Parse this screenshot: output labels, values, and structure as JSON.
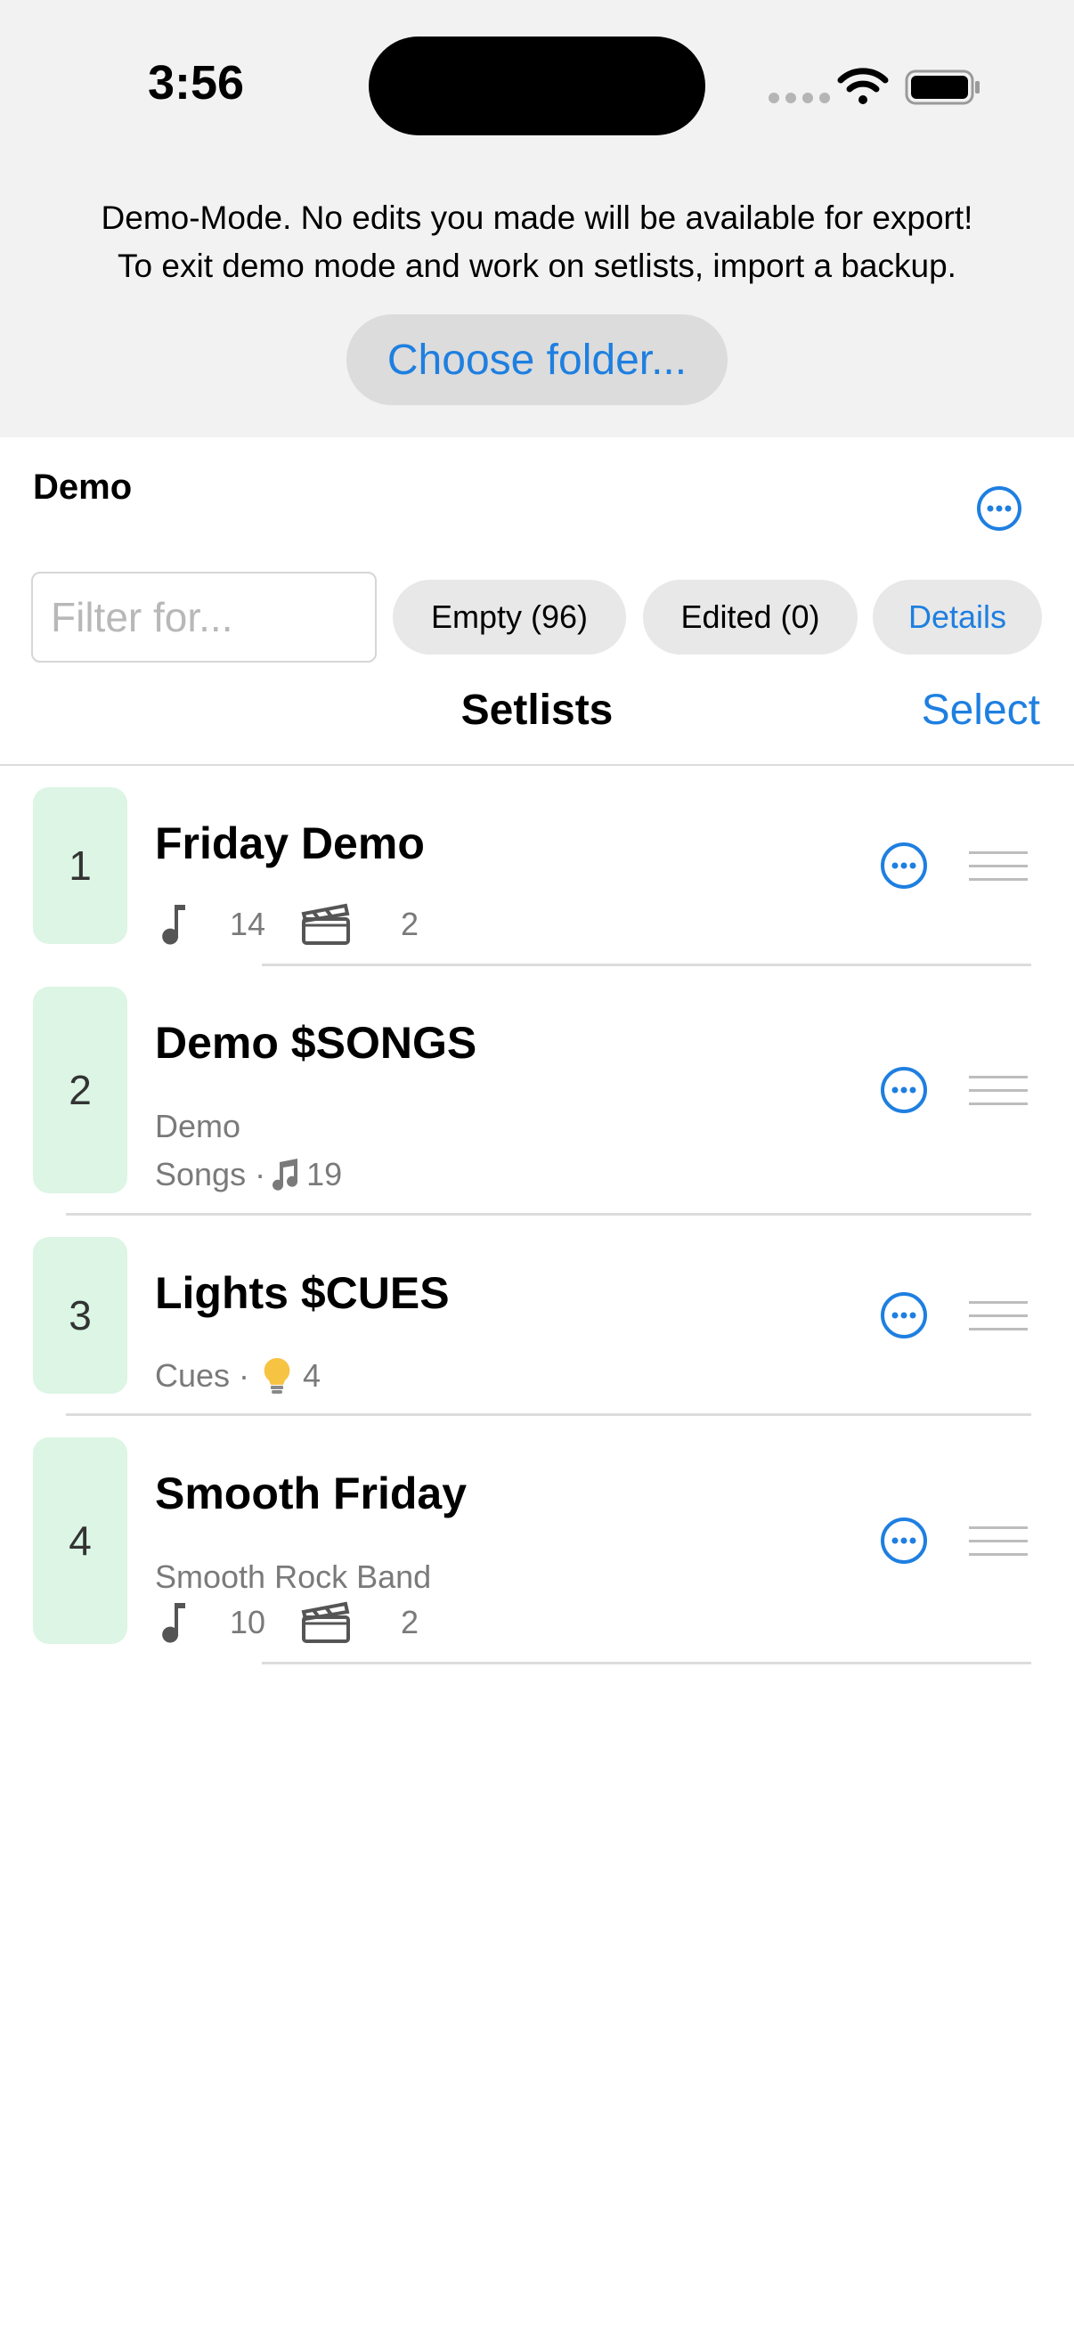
{
  "status_bar": {
    "time": "3:56"
  },
  "banner": {
    "line1": "Demo-Mode. No edits you made will be available for export!",
    "line2": "To exit demo mode and work on setlists, import a backup.",
    "choose_folder_label": "Choose folder..."
  },
  "folder": {
    "title": "Demo"
  },
  "filter": {
    "placeholder": "Filter for...",
    "value": "",
    "chips": {
      "empty": "Empty (96)",
      "edited": "Edited (0)",
      "details": "Details"
    }
  },
  "list": {
    "title": "Setlists",
    "select_label": "Select",
    "items": [
      {
        "number": "1",
        "title": "Friday Demo",
        "songs": "14",
        "cues": "2"
      },
      {
        "number": "2",
        "title": "Demo $SONGS",
        "sub": "Demo",
        "meta_prefix": "Songs ·",
        "meta_count": "19"
      },
      {
        "number": "3",
        "title": "Lights $CUES",
        "meta_prefix": "Cues ·",
        "meta_count": "4"
      },
      {
        "number": "4",
        "title": "Smooth Friday",
        "sub": "Smooth Rock Band",
        "songs": "10",
        "cues": "2"
      }
    ]
  },
  "colors": {
    "accent": "#1e7fe0",
    "badge_bg": "#dcf5e4",
    "banner_bg": "#f2f2f2",
    "secondary_text": "#7a7a7a"
  }
}
